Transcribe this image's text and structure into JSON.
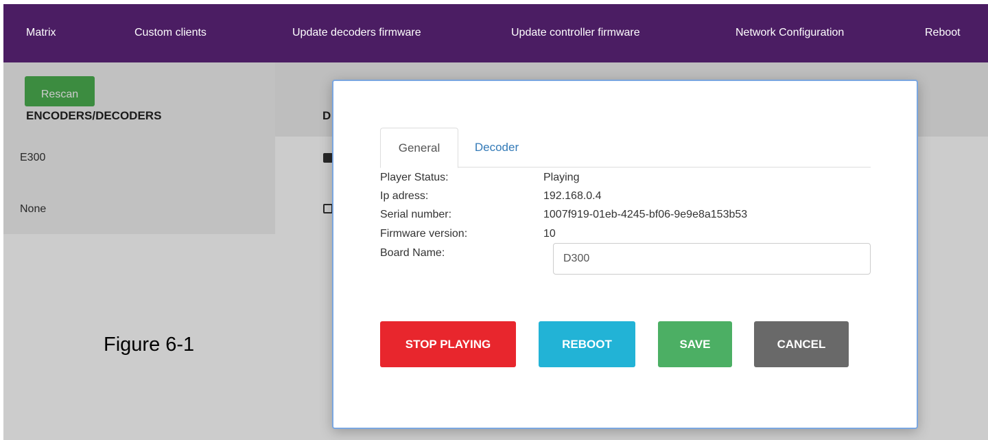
{
  "nav": {
    "items": [
      {
        "label": "Matrix"
      },
      {
        "label": "Custom clients"
      },
      {
        "label": "Update decoders firmware"
      },
      {
        "label": "Update controller firmware"
      },
      {
        "label": "Network Configuration"
      },
      {
        "label": "Reboot"
      }
    ]
  },
  "background": {
    "rescan_label": "Rescan",
    "heading_encoders": "ENCODERS/DECODERS",
    "heading_second_partial": "D",
    "rows": [
      {
        "label": "E300",
        "checked": true
      },
      {
        "label": "None",
        "checked": false
      }
    ]
  },
  "figure_label": "Figure 6-1",
  "modal": {
    "tabs": [
      {
        "label": "General",
        "active": true
      },
      {
        "label": "Decoder",
        "active": false
      }
    ],
    "info": [
      {
        "label": "Player Status:",
        "value": "Playing"
      },
      {
        "label": "Ip adress:",
        "value": "192.168.0.4"
      },
      {
        "label": "Serial number:",
        "value": "1007f919-01eb-4245-bf06-9e9e8a153b53"
      },
      {
        "label": "Firmware version:",
        "value": "10"
      },
      {
        "label": "Board Name:",
        "value": ""
      }
    ],
    "board_name_value": "D300",
    "buttons": {
      "stop_playing": "STOP PLAYING",
      "reboot": "REBOOT",
      "save": "SAVE",
      "cancel": "CANCEL"
    }
  },
  "colors": {
    "navbar": "#4b1d63",
    "stop": "#e8262d",
    "reboot": "#22b3d6",
    "save": "#4caf64",
    "cancel": "#696969",
    "rescan": "#4caf50"
  }
}
